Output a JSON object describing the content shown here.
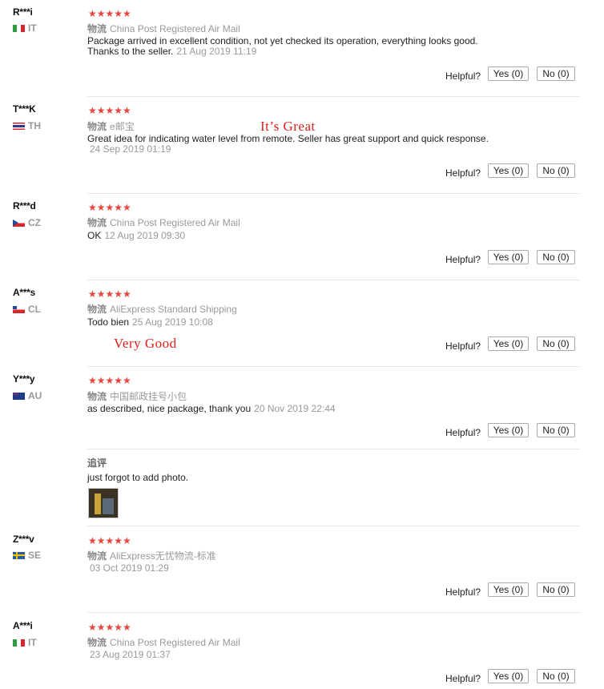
{
  "helpful_label": "Helpful?",
  "yes_label": "Yes (0)",
  "no_label": "No (0)",
  "stars": "★★★★★",
  "shipping_label": "物流",
  "followup_label": "追评",
  "annotations": {
    "great": "It’s Great",
    "good": "Very Good"
  },
  "reviews": [
    {
      "user": "R***i",
      "country": "IT",
      "shipping": "China Post Registered Air Mail",
      "text": "Package arrived in excellent condition, not yet checked its operation, everything looks good.",
      "text2": "Thanks to the seller.",
      "date": "21 Aug 2019 11:19"
    },
    {
      "user": "T***K",
      "country": "TH",
      "shipping": "e邮宝",
      "text": "Great idea for indicating water level from remote. Seller has great support and quick response.",
      "date": "24 Sep 2019 01:19"
    },
    {
      "user": "R***d",
      "country": "CZ",
      "shipping": "China Post Registered Air Mail",
      "text": "OK",
      "date": "12 Aug 2019 09:30"
    },
    {
      "user": "A***s",
      "country": "CL",
      "shipping": "AliExpress Standard Shipping",
      "text": "Todo bien",
      "date": "25 Aug 2019 10:08"
    },
    {
      "user": "Y***y",
      "country": "AU",
      "shipping": "中国邮政挂号小包",
      "text": "as described, nice package, thank you",
      "date": "20 Nov 2019 22:44",
      "followup": "just forgot to add photo."
    },
    {
      "user": "Z***v",
      "country": "SE",
      "shipping": "AliExpress无忧物流-标准",
      "text": "",
      "date": "03 Oct 2019 01:29"
    },
    {
      "user": "A***i",
      "country": "IT",
      "shipping": "China Post Registered Air Mail",
      "text": "",
      "date": "23 Aug 2019 01:37"
    }
  ]
}
